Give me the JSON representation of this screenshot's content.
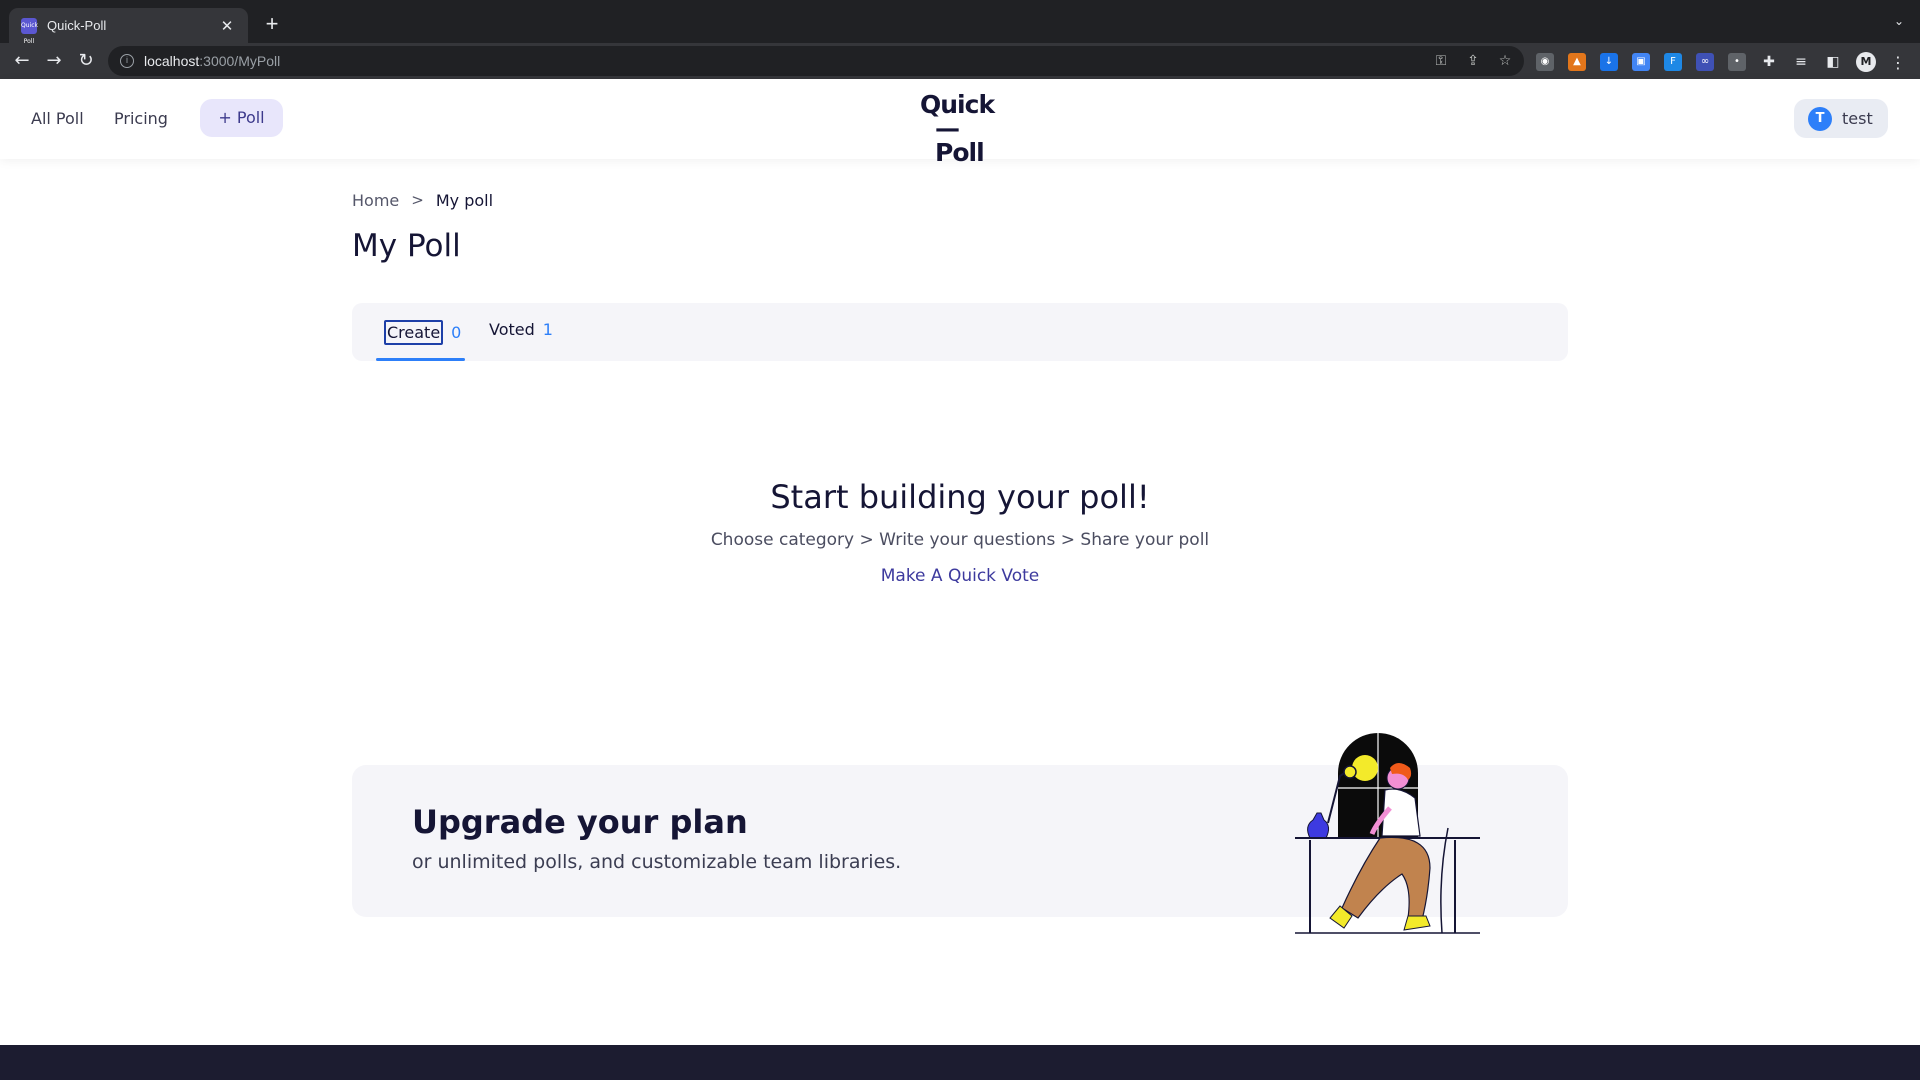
{
  "browser": {
    "tab_title": "Quick-Poll",
    "favicon_text": "Quick Poll",
    "url_host": "localhost",
    "url_path": ":3000/MyPoll"
  },
  "header": {
    "nav_all_poll": "All Poll",
    "nav_pricing": "Pricing",
    "add_poll_label": "+ Poll",
    "logo_line1": "Quick",
    "logo_line2": "—Poll",
    "user_initial": "T",
    "user_name": "test"
  },
  "breadcrumb": {
    "home": "Home",
    "separator": ">",
    "current": "My poll"
  },
  "page_title": "My Poll",
  "tabs": [
    {
      "label": "Create",
      "count": "0",
      "active": true
    },
    {
      "label": "Voted",
      "count": "1",
      "active": false
    }
  ],
  "empty_state": {
    "title": "Start building your poll!",
    "steps": "Choose category > Write your questions > Share your poll",
    "link": "Make A Quick Vote"
  },
  "upgrade": {
    "title": "Upgrade your plan",
    "subtitle": "or unlimited polls, and customizable team libraries."
  },
  "colors": {
    "accent": "#2d7ff9",
    "brand_purple": "#3d3a9e",
    "dark": "#151535",
    "footer": "#1c1c30"
  }
}
